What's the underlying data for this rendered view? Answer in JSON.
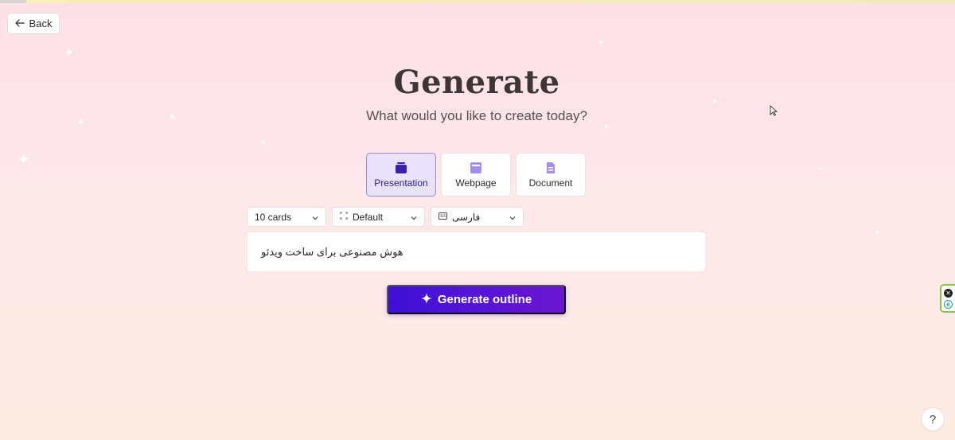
{
  "nav": {
    "back_label": "Back"
  },
  "header": {
    "title": "Generate",
    "subtitle": "What would you like to create today?"
  },
  "content_types": [
    {
      "label": "Presentation",
      "selected": true
    },
    {
      "label": "Webpage",
      "selected": false
    },
    {
      "label": "Document",
      "selected": false
    }
  ],
  "options": {
    "cards": "10 cards",
    "theme": "Default",
    "language": "فارسی"
  },
  "prompt": {
    "value": "هوش مصنوعی برای ساخت ویدئو"
  },
  "generate_button": {
    "label": "Generate outline"
  },
  "help": {
    "label": "?"
  },
  "colors": {
    "accent": "#4a12d6",
    "selected_card_bg": "#e9e2fb",
    "selected_card_border": "#9c83f3"
  }
}
